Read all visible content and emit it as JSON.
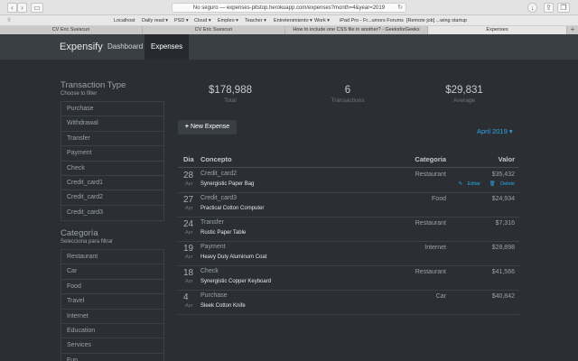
{
  "browser": {
    "url": "No seguro — expenses-pitstop.herokuapp.com/expenses?month=4&year=2019",
    "bookmarks": [
      "Localhost",
      "Daily read ▾",
      "PSD ▾",
      "Cloud ▾",
      "Empleo ▾",
      "Teacher ▾",
      "Entretenimiento ▾",
      "Work ▾",
      "iPad Pro - Fr...umors Forums",
      "[Remote job] ...wing startup"
    ],
    "tabs": [
      "CV Eric Suescun",
      "CV Eric Suescun",
      "How to include one CSS file in another? - GeeksforGeeks",
      "Expenses"
    ],
    "active_tab": 3
  },
  "nav": {
    "brand": "Expensify",
    "links": [
      "Dashboard",
      "Expenses"
    ],
    "active": "Expenses"
  },
  "sidebar": {
    "type_title": "Transaction Type",
    "type_subtitle": "Choose to filter",
    "types": [
      "Purchase",
      "Withdrawal",
      "Transfer",
      "Payment",
      "Check",
      "Credit_card1",
      "Credit_card2",
      "Credit_card3"
    ],
    "cat_title": "Categoría",
    "cat_subtitle": "Selecciona para filtrar",
    "categories": [
      "Restaurant",
      "Car",
      "Food",
      "Travel",
      "Internet",
      "Education",
      "Services",
      "Fun"
    ]
  },
  "stats": {
    "total": {
      "value": "$178,988",
      "label": "Total"
    },
    "transactions": {
      "value": "6",
      "label": "Transactions"
    },
    "average": {
      "value": "$29,831",
      "label": "Average"
    }
  },
  "new_expense_label": "New Expense",
  "month_selector": "April 2019 ▾",
  "table": {
    "headers": {
      "dia": "Dia",
      "concepto": "Concepto",
      "categoria": "Categoria",
      "valor": "Valor"
    },
    "rows": [
      {
        "day": "28",
        "month": "Apr",
        "concept": "Credit_card2",
        "product": "Synergistic Paper Bag",
        "category": "Restaurant",
        "value": "$35,432"
      },
      {
        "day": "27",
        "month": "Apr",
        "concept": "Credit_card3",
        "product": "Practical Cotton Computer",
        "category": "Food",
        "value": "$24,934"
      },
      {
        "day": "24",
        "month": "Apr",
        "concept": "Transfer",
        "product": "Rustic Paper Table",
        "category": "Restaurant",
        "value": "$7,316"
      },
      {
        "day": "19",
        "month": "Apr",
        "concept": "Payment",
        "product": "Heavy Duty Aluminum Coat",
        "category": "Internet",
        "value": "$28,898"
      },
      {
        "day": "18",
        "month": "Apr",
        "concept": "Check",
        "product": "Synergistic Copper Keyboard",
        "category": "Restaurant",
        "value": "$41,566"
      },
      {
        "day": "4",
        "month": "Apr",
        "concept": "Purchase",
        "product": "Sleek Cotton Knife",
        "category": "Car",
        "value": "$40,842"
      }
    ],
    "edit_label": "Editar",
    "delete_label": "Delete"
  }
}
